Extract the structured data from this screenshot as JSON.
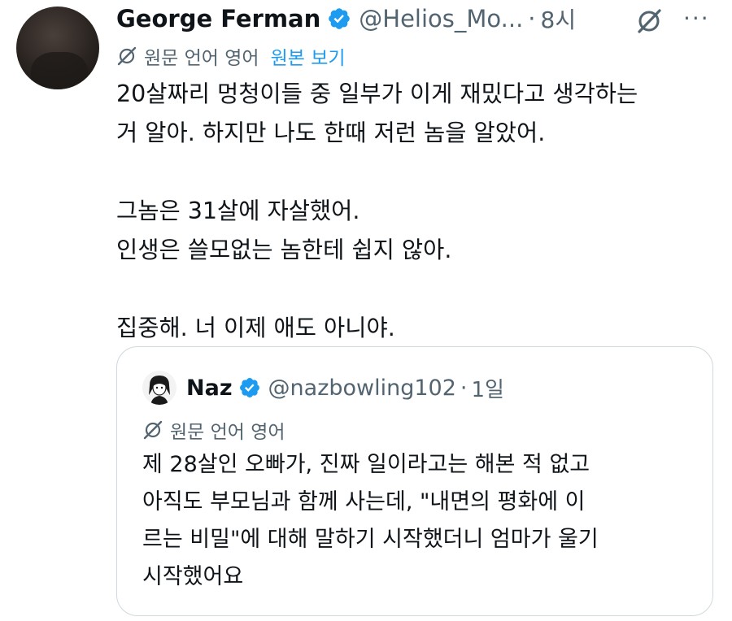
{
  "tweet": {
    "author_name": "George Ferman",
    "handle": "@Helios_Mo...",
    "separator": "·",
    "time": "8시",
    "translation_note": "원문 언어 영어",
    "show_original_label": "원본 보기",
    "text_lines": [
      "20살짜리 멍청이들 중 일부가 이게 재밌다고 생각하는",
      "거 알아. 하지만 나도 한때 저런 놈을 알았어.",
      "",
      "그놈은 31살에 자살했어.",
      "인생은 쓸모없는 놈한테 쉽지 않아.",
      "",
      "집중해. 너 이제 애도 아니야."
    ]
  },
  "quoted_tweet": {
    "author_name": "Naz",
    "handle": "@nazbowling102",
    "separator": "·",
    "time": "1일",
    "translation_note": "원문 언어 영어",
    "text_lines": [
      "제 28살인 오빠가, 진짜 일이라고는 해본 적 없고",
      "아직도 부모님과 함께 사는데, \"내면의 평화에 이",
      "르는 비밀\"에 대해 말하기 시작했더니 엄마가 울기",
      "시작했어요"
    ]
  },
  "icons": {
    "verified": "verified-badge-icon",
    "grok": "grok-icon",
    "more": "more-options-icon",
    "translate": "translate-icon"
  },
  "colors": {
    "text_primary": "#0f1419",
    "text_secondary": "#536471",
    "accent": "#1d9bf0",
    "border": "#cfd9de"
  }
}
